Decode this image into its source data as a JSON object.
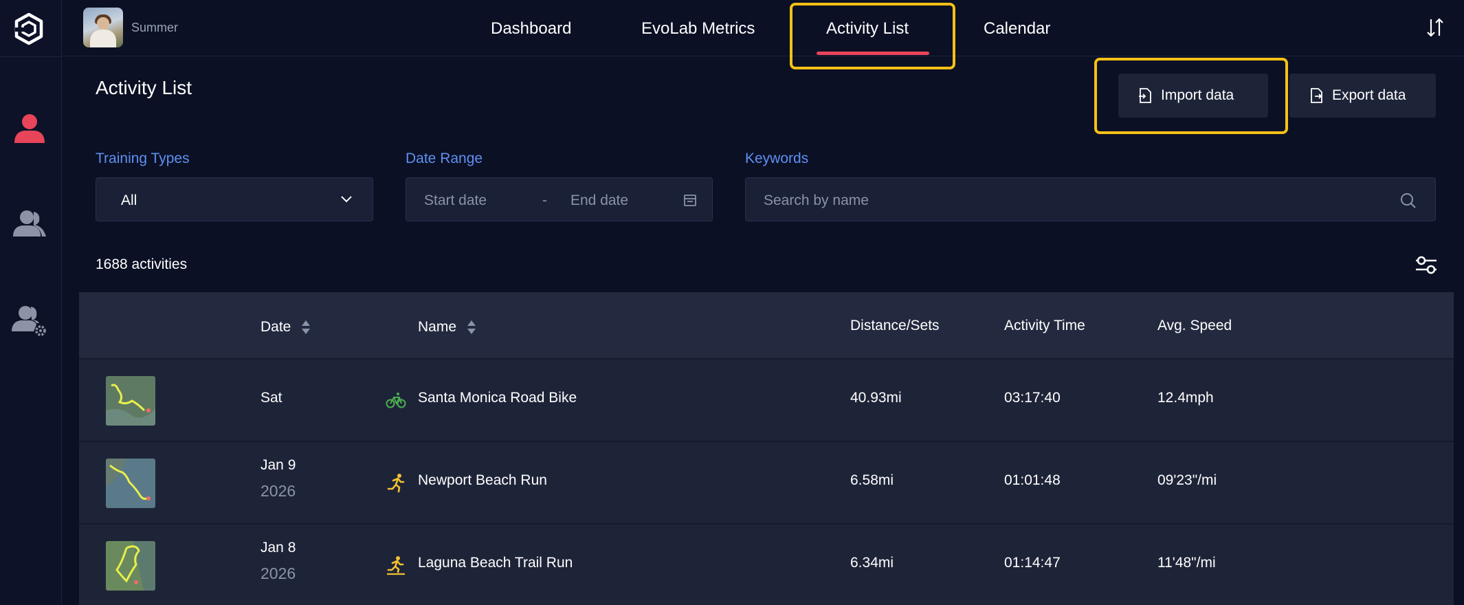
{
  "user": {
    "name": "Summer"
  },
  "nav": {
    "tabs": [
      {
        "label": "Dashboard"
      },
      {
        "label": "EvoLab Metrics"
      },
      {
        "label": "Activity List"
      },
      {
        "label": "Calendar"
      }
    ],
    "active_tab": "Activity List"
  },
  "page": {
    "title": "Activity List",
    "import_label": "Import data",
    "export_label": "Export data"
  },
  "filters": {
    "training_types": {
      "label": "Training Types",
      "value": "All"
    },
    "date_range": {
      "label": "Date Range",
      "start_placeholder": "Start date",
      "separator": "-",
      "end_placeholder": "End date"
    },
    "keywords": {
      "label": "Keywords",
      "placeholder": "Search by name"
    }
  },
  "summary": {
    "count_text": "1688 activities"
  },
  "table": {
    "headers": {
      "date": "Date",
      "name": "Name",
      "distance": "Distance/Sets",
      "time": "Activity Time",
      "speed": "Avg. Speed"
    },
    "rows": [
      {
        "date": "Sat",
        "year": "",
        "type": "bike-icon",
        "name": "Santa Monica Road Bike",
        "distance": "40.93mi",
        "time": "03:17:40",
        "speed": "12.4mph"
      },
      {
        "date": "Jan 9",
        "year": "2026",
        "type": "run-icon",
        "name": "Newport Beach Run",
        "distance": "6.58mi",
        "time": "01:01:48",
        "speed": "09'23\"/mi"
      },
      {
        "date": "Jan 8",
        "year": "2026",
        "type": "trail-run-icon",
        "name": "Laguna Beach Trail Run",
        "distance": "6.34mi",
        "time": "01:14:47",
        "speed": "11'48\"/mi"
      }
    ]
  },
  "colors": {
    "background": "#0b1024",
    "accent_red": "#e8445a",
    "label_blue": "#5e90f2",
    "highlight_yellow": "#f5c116",
    "bike_green": "#4caf50",
    "run_yellow": "#f2c230"
  }
}
